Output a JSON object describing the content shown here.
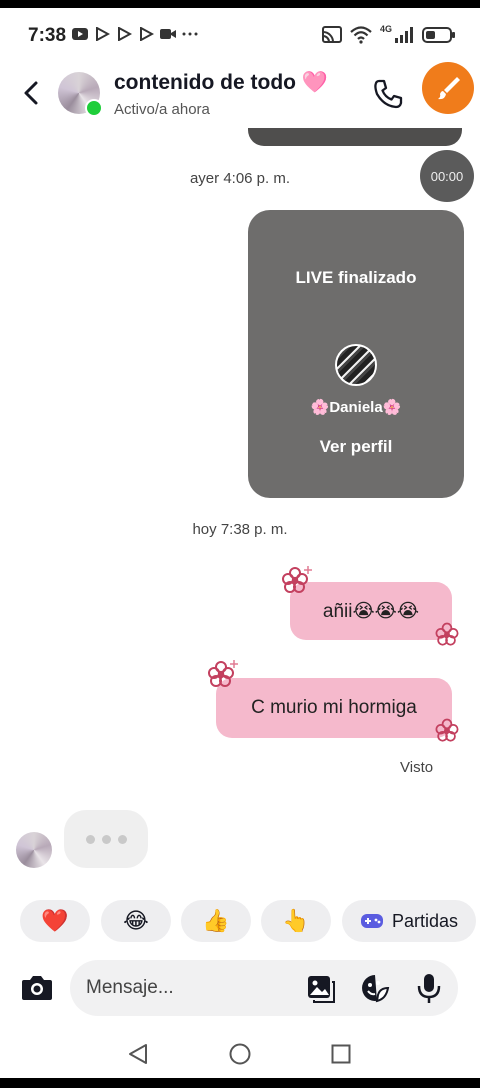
{
  "status_bar": {
    "time": "7:38",
    "network": "4G",
    "icons": [
      "youtube-icon",
      "play-icon",
      "play-icon",
      "play-icon",
      "video-icon",
      "more-icon",
      "cast-icon",
      "wifi-icon",
      "signal-icon",
      "battery-icon"
    ]
  },
  "header": {
    "title": "contenido de todo 🩷",
    "status": "Activo/a ahora",
    "online_color": "#1fce3a",
    "fab_color": "#f07c1b"
  },
  "chat": {
    "timestamp_1": "ayer 4:06 p. m.",
    "timer": "00:00",
    "live_card": {
      "title": "LIVE finalizado",
      "name": "🌸Daniela🌸",
      "link": "Ver perfil"
    },
    "timestamp_2": "hoy 7:38 p. m.",
    "messages": [
      {
        "text": "añii😭😭😭"
      },
      {
        "text": "C murio mi hormiga"
      }
    ],
    "bubble_color": "#f5b9cc",
    "seen": "Visto"
  },
  "quick_replies": [
    {
      "emoji": "❤️"
    },
    {
      "emoji": "😂"
    },
    {
      "emoji": "👍"
    },
    {
      "emoji": "👆"
    },
    {
      "label": "Partidas",
      "icon": "gamepad-icon"
    }
  ],
  "composer": {
    "placeholder": "Mensaje..."
  }
}
